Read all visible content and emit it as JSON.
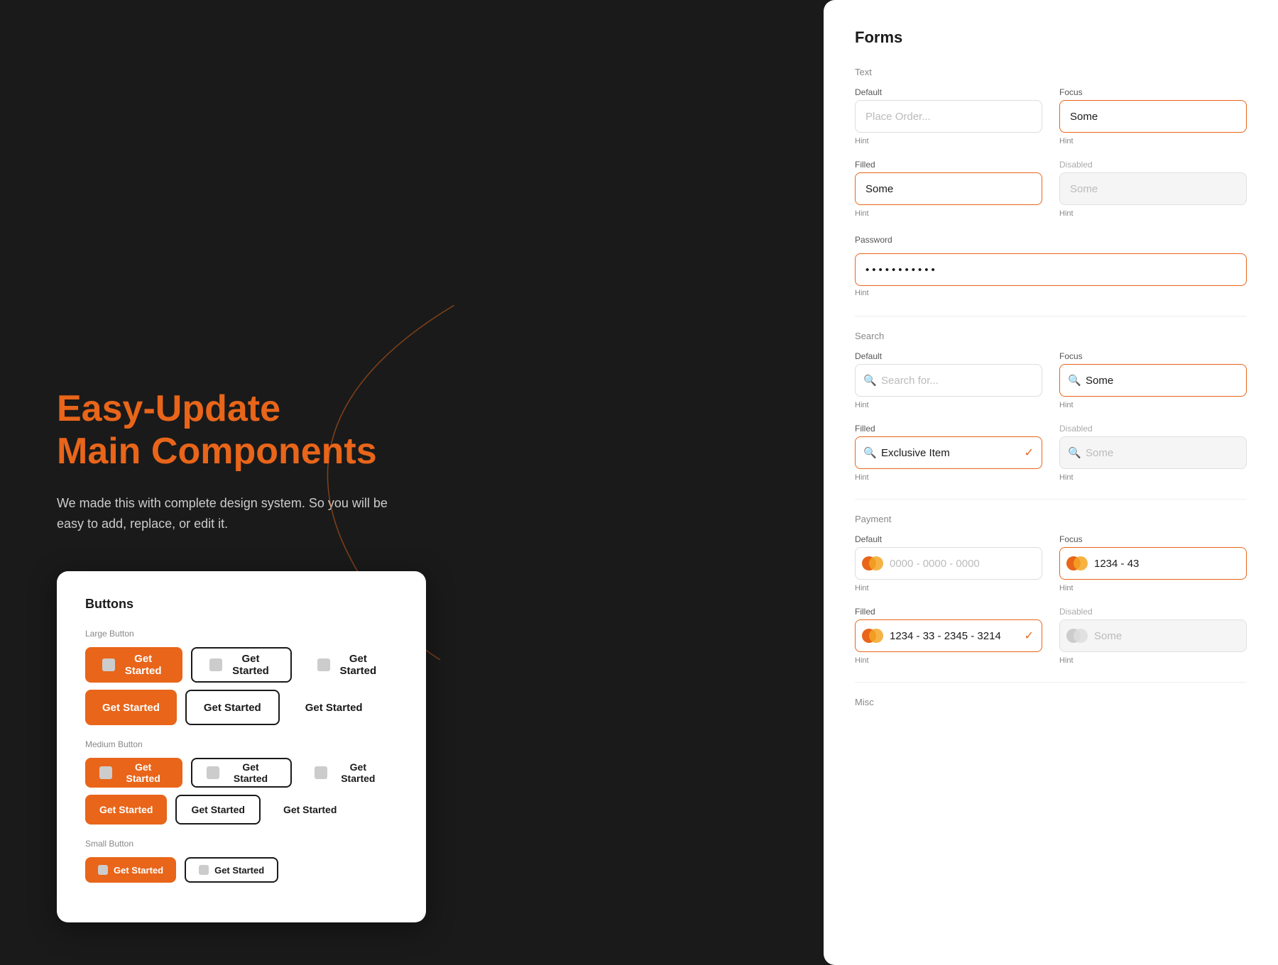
{
  "hero": {
    "title_line1": "Easy-Update",
    "title_line2": "Main Components",
    "description": "We made this with complete design system. So you will be easy to add, replace, or edit it."
  },
  "buttons_card": {
    "title": "Buttons",
    "large_label": "Large Button",
    "medium_label": "Medium Button",
    "small_label": "Small Button",
    "btn_label": "Get Started"
  },
  "forms": {
    "panel_title": "Forms",
    "text_section": "Text",
    "text_default_label": "Default",
    "text_default_placeholder": "Place Order...",
    "text_focus_label": "Focus",
    "text_focus_value": "Some",
    "text_hint": "Hint",
    "text_filled_label": "Filled",
    "text_filled_value": "Some",
    "text_disabled_label": "Disabled",
    "text_disabled_value": "Some",
    "password_label": "Password",
    "password_value": "••••••••",
    "password_hint": "Hint",
    "search_section": "Search",
    "search_default_label": "Default",
    "search_default_placeholder": "Search for...",
    "search_focus_label": "Focus",
    "search_focus_value": "Some",
    "search_hint": "Hint",
    "search_filled_label": "Filled",
    "search_filled_value": "Exclusive Item",
    "search_disabled_label": "Disabled",
    "search_disabled_value": "Some",
    "payment_section": "Payment",
    "payment_default_label": "Default",
    "payment_default_placeholder": "0000 - 0000 - 0000",
    "payment_focus_label": "Focus",
    "payment_focus_value": "1234 - 43",
    "payment_hint": "Hint",
    "payment_filled_label": "Filled",
    "payment_filled_value": "1234 - 33 - 2345 - 3214",
    "payment_disabled_label": "Disabled",
    "payment_disabled_value": "Some",
    "misc_section": "Misc"
  },
  "colors": {
    "orange": "#e8651a",
    "orange_light": "#f5a623",
    "text_dark": "#1a1a1a",
    "text_gray": "#888888",
    "border_default": "#dddddd",
    "bg_white": "#ffffff",
    "bg_dark": "#1a1a1a"
  }
}
